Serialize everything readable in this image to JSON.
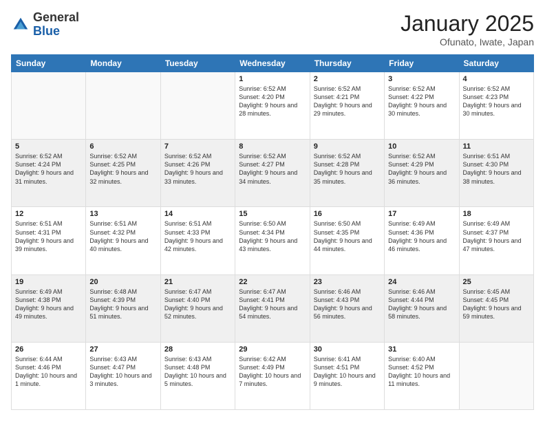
{
  "logo": {
    "general": "General",
    "blue": "Blue"
  },
  "title": "January 2025",
  "location": "Ofunato, Iwate, Japan",
  "weekdays": [
    "Sunday",
    "Monday",
    "Tuesday",
    "Wednesday",
    "Thursday",
    "Friday",
    "Saturday"
  ],
  "weeks": [
    [
      {
        "day": "",
        "sunrise": "",
        "sunset": "",
        "daylight": ""
      },
      {
        "day": "",
        "sunrise": "",
        "sunset": "",
        "daylight": ""
      },
      {
        "day": "",
        "sunrise": "",
        "sunset": "",
        "daylight": ""
      },
      {
        "day": "1",
        "sunrise": "Sunrise: 6:52 AM",
        "sunset": "Sunset: 4:20 PM",
        "daylight": "Daylight: 9 hours and 28 minutes."
      },
      {
        "day": "2",
        "sunrise": "Sunrise: 6:52 AM",
        "sunset": "Sunset: 4:21 PM",
        "daylight": "Daylight: 9 hours and 29 minutes."
      },
      {
        "day": "3",
        "sunrise": "Sunrise: 6:52 AM",
        "sunset": "Sunset: 4:22 PM",
        "daylight": "Daylight: 9 hours and 30 minutes."
      },
      {
        "day": "4",
        "sunrise": "Sunrise: 6:52 AM",
        "sunset": "Sunset: 4:23 PM",
        "daylight": "Daylight: 9 hours and 30 minutes."
      }
    ],
    [
      {
        "day": "5",
        "sunrise": "Sunrise: 6:52 AM",
        "sunset": "Sunset: 4:24 PM",
        "daylight": "Daylight: 9 hours and 31 minutes."
      },
      {
        "day": "6",
        "sunrise": "Sunrise: 6:52 AM",
        "sunset": "Sunset: 4:25 PM",
        "daylight": "Daylight: 9 hours and 32 minutes."
      },
      {
        "day": "7",
        "sunrise": "Sunrise: 6:52 AM",
        "sunset": "Sunset: 4:26 PM",
        "daylight": "Daylight: 9 hours and 33 minutes."
      },
      {
        "day": "8",
        "sunrise": "Sunrise: 6:52 AM",
        "sunset": "Sunset: 4:27 PM",
        "daylight": "Daylight: 9 hours and 34 minutes."
      },
      {
        "day": "9",
        "sunrise": "Sunrise: 6:52 AM",
        "sunset": "Sunset: 4:28 PM",
        "daylight": "Daylight: 9 hours and 35 minutes."
      },
      {
        "day": "10",
        "sunrise": "Sunrise: 6:52 AM",
        "sunset": "Sunset: 4:29 PM",
        "daylight": "Daylight: 9 hours and 36 minutes."
      },
      {
        "day": "11",
        "sunrise": "Sunrise: 6:51 AM",
        "sunset": "Sunset: 4:30 PM",
        "daylight": "Daylight: 9 hours and 38 minutes."
      }
    ],
    [
      {
        "day": "12",
        "sunrise": "Sunrise: 6:51 AM",
        "sunset": "Sunset: 4:31 PM",
        "daylight": "Daylight: 9 hours and 39 minutes."
      },
      {
        "day": "13",
        "sunrise": "Sunrise: 6:51 AM",
        "sunset": "Sunset: 4:32 PM",
        "daylight": "Daylight: 9 hours and 40 minutes."
      },
      {
        "day": "14",
        "sunrise": "Sunrise: 6:51 AM",
        "sunset": "Sunset: 4:33 PM",
        "daylight": "Daylight: 9 hours and 42 minutes."
      },
      {
        "day": "15",
        "sunrise": "Sunrise: 6:50 AM",
        "sunset": "Sunset: 4:34 PM",
        "daylight": "Daylight: 9 hours and 43 minutes."
      },
      {
        "day": "16",
        "sunrise": "Sunrise: 6:50 AM",
        "sunset": "Sunset: 4:35 PM",
        "daylight": "Daylight: 9 hours and 44 minutes."
      },
      {
        "day": "17",
        "sunrise": "Sunrise: 6:49 AM",
        "sunset": "Sunset: 4:36 PM",
        "daylight": "Daylight: 9 hours and 46 minutes."
      },
      {
        "day": "18",
        "sunrise": "Sunrise: 6:49 AM",
        "sunset": "Sunset: 4:37 PM",
        "daylight": "Daylight: 9 hours and 47 minutes."
      }
    ],
    [
      {
        "day": "19",
        "sunrise": "Sunrise: 6:49 AM",
        "sunset": "Sunset: 4:38 PM",
        "daylight": "Daylight: 9 hours and 49 minutes."
      },
      {
        "day": "20",
        "sunrise": "Sunrise: 6:48 AM",
        "sunset": "Sunset: 4:39 PM",
        "daylight": "Daylight: 9 hours and 51 minutes."
      },
      {
        "day": "21",
        "sunrise": "Sunrise: 6:47 AM",
        "sunset": "Sunset: 4:40 PM",
        "daylight": "Daylight: 9 hours and 52 minutes."
      },
      {
        "day": "22",
        "sunrise": "Sunrise: 6:47 AM",
        "sunset": "Sunset: 4:41 PM",
        "daylight": "Daylight: 9 hours and 54 minutes."
      },
      {
        "day": "23",
        "sunrise": "Sunrise: 6:46 AM",
        "sunset": "Sunset: 4:43 PM",
        "daylight": "Daylight: 9 hours and 56 minutes."
      },
      {
        "day": "24",
        "sunrise": "Sunrise: 6:46 AM",
        "sunset": "Sunset: 4:44 PM",
        "daylight": "Daylight: 9 hours and 58 minutes."
      },
      {
        "day": "25",
        "sunrise": "Sunrise: 6:45 AM",
        "sunset": "Sunset: 4:45 PM",
        "daylight": "Daylight: 9 hours and 59 minutes."
      }
    ],
    [
      {
        "day": "26",
        "sunrise": "Sunrise: 6:44 AM",
        "sunset": "Sunset: 4:46 PM",
        "daylight": "Daylight: 10 hours and 1 minute."
      },
      {
        "day": "27",
        "sunrise": "Sunrise: 6:43 AM",
        "sunset": "Sunset: 4:47 PM",
        "daylight": "Daylight: 10 hours and 3 minutes."
      },
      {
        "day": "28",
        "sunrise": "Sunrise: 6:43 AM",
        "sunset": "Sunset: 4:48 PM",
        "daylight": "Daylight: 10 hours and 5 minutes."
      },
      {
        "day": "29",
        "sunrise": "Sunrise: 6:42 AM",
        "sunset": "Sunset: 4:49 PM",
        "daylight": "Daylight: 10 hours and 7 minutes."
      },
      {
        "day": "30",
        "sunrise": "Sunrise: 6:41 AM",
        "sunset": "Sunset: 4:51 PM",
        "daylight": "Daylight: 10 hours and 9 minutes."
      },
      {
        "day": "31",
        "sunrise": "Sunrise: 6:40 AM",
        "sunset": "Sunset: 4:52 PM",
        "daylight": "Daylight: 10 hours and 11 minutes."
      },
      {
        "day": "",
        "sunrise": "",
        "sunset": "",
        "daylight": ""
      }
    ]
  ]
}
